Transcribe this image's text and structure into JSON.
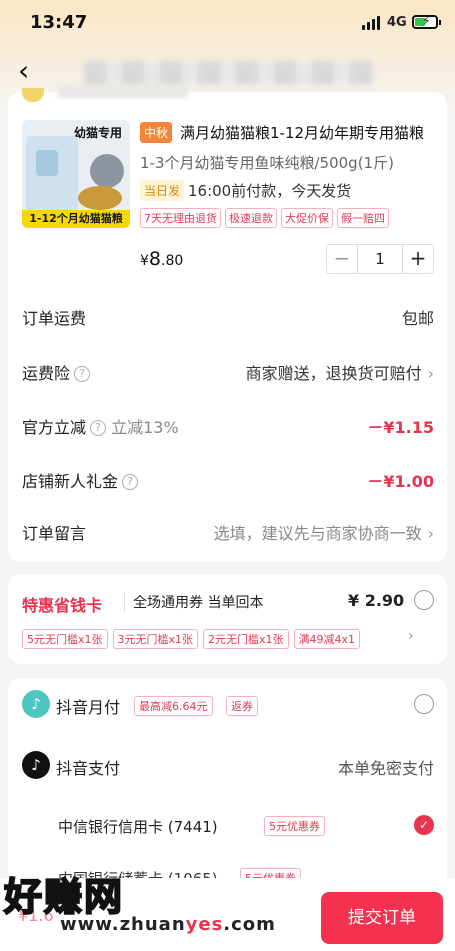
{
  "status": {
    "time": "13:47",
    "network": "4G"
  },
  "product": {
    "image_title": "幼猫专用",
    "image_banner": "1-12个月幼猫猫粮",
    "tag": "中秋",
    "title": "满月幼猫猫粮1-12月幼年期专用猫粮",
    "spec": "1-3个月幼猫专用鱼味纯粮/500g(1斤)",
    "same_day_tag": "当日发",
    "shipping_note": "16:00前付款，今天发货",
    "services": [
      "7天无理由退货",
      "极速退款",
      "大促价保",
      "假一赔四"
    ],
    "price_symbol": "¥",
    "price_int": "8",
    "price_dec": ".80",
    "quantity": "1",
    "minus": "−",
    "plus": "+"
  },
  "rows": {
    "freight": {
      "label": "订单运费",
      "value": "包邮"
    },
    "insurance": {
      "label": "运费险",
      "value": "商家赠送，退换货可赔付"
    },
    "official": {
      "label": "官方立减",
      "sub": "立减13%",
      "value": "－¥1.15"
    },
    "newgift": {
      "label": "店铺新人礼金",
      "value": "－¥1.00"
    },
    "message": {
      "label": "订单留言",
      "placeholder": "选填，建议先与商家协商一致"
    }
  },
  "savecard": {
    "title": "特惠省钱卡",
    "desc": "全场通用券 当单回本",
    "price": "¥ 2.90",
    "coupons": [
      "5元无门槛x1张",
      "3元无门槛x1张",
      "2元无门槛x1张",
      "满49减4x1"
    ]
  },
  "payment": {
    "monthly": {
      "name": "抖音月付",
      "tag1": "最高减6.64元",
      "tag2": "返券"
    },
    "douyin": {
      "name": "抖音支付",
      "note": "本单免密支付"
    },
    "bank1": {
      "name": "中信银行信用卡 (7441)",
      "tag": "5元优惠券"
    },
    "bank2": {
      "name": "中国银行储蓄卡 (1065)",
      "tag": "5元优惠券"
    }
  },
  "footer": {
    "total": "¥1.6",
    "submit": "提交订单",
    "watermark": "好赚网",
    "watermark_url_a": "www.zhuan",
    "watermark_url_b": "yes",
    "watermark_url_c": ".com"
  },
  "icons": [
    "back-icon",
    "help-icon",
    "chevron-right-icon",
    "radio-icon",
    "check-icon",
    "douyin-icon"
  ]
}
